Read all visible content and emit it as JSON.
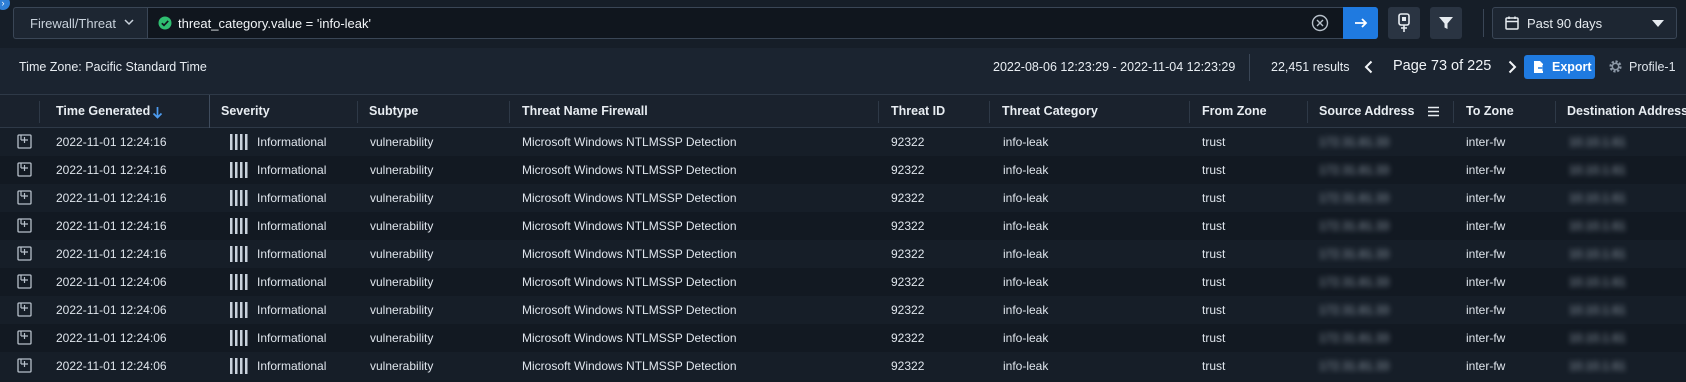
{
  "toolbar": {
    "datasource": "Firewall/Threat",
    "query": "threat_category.value = 'info-leak'",
    "time_range": "Past 90 days",
    "icons": {
      "status": "check-circle-icon",
      "clear": "clear-x-icon",
      "run": "arrow-right-icon",
      "query_builder": "query-builder-icon",
      "filter": "filter-icon",
      "calendar": "calendar-icon",
      "dropdown": "chevron-down-icon"
    },
    "colors": {
      "accent": "#1f7ae0",
      "status_ok": "#2fbf71"
    }
  },
  "info": {
    "timezone": "Time Zone: Pacific Standard Time",
    "date_range": "2022-08-06 12:23:29 - 2022-11-04 12:23:29",
    "results": "22,451 results",
    "page": "Page 73 of 225",
    "export_label": "Export",
    "profile_label": "Profile-1"
  },
  "table": {
    "columns": [
      "Time Generated",
      "Severity",
      "Subtype",
      "Threat Name Firewall",
      "Threat ID",
      "Threat Category",
      "From Zone",
      "Source Address",
      "To Zone",
      "Destination Address"
    ],
    "sort": {
      "column": "Time Generated",
      "direction": "descending"
    },
    "rows": [
      {
        "time": "2022-11-01 12:24:16",
        "severity": "Informational",
        "subtype": "vulnerability",
        "threat_name": "Microsoft Windows NTLMSSP Detection",
        "threat_id": "92322",
        "category": "info-leak",
        "from_zone": "trust",
        "source": "172.31.81.33",
        "to_zone": "inter-fw",
        "destination": "10.10.1.61"
      },
      {
        "time": "2022-11-01 12:24:16",
        "severity": "Informational",
        "subtype": "vulnerability",
        "threat_name": "Microsoft Windows NTLMSSP Detection",
        "threat_id": "92322",
        "category": "info-leak",
        "from_zone": "trust",
        "source": "172.31.81.33",
        "to_zone": "inter-fw",
        "destination": "10.10.1.61"
      },
      {
        "time": "2022-11-01 12:24:16",
        "severity": "Informational",
        "subtype": "vulnerability",
        "threat_name": "Microsoft Windows NTLMSSP Detection",
        "threat_id": "92322",
        "category": "info-leak",
        "from_zone": "trust",
        "source": "172.31.81.33",
        "to_zone": "inter-fw",
        "destination": "10.10.1.61"
      },
      {
        "time": "2022-11-01 12:24:16",
        "severity": "Informational",
        "subtype": "vulnerability",
        "threat_name": "Microsoft Windows NTLMSSP Detection",
        "threat_id": "92322",
        "category": "info-leak",
        "from_zone": "trust",
        "source": "172.31.81.33",
        "to_zone": "inter-fw",
        "destination": "10.10.1.61"
      },
      {
        "time": "2022-11-01 12:24:16",
        "severity": "Informational",
        "subtype": "vulnerability",
        "threat_name": "Microsoft Windows NTLMSSP Detection",
        "threat_id": "92322",
        "category": "info-leak",
        "from_zone": "trust",
        "source": "172.31.81.33",
        "to_zone": "inter-fw",
        "destination": "10.10.1.61"
      },
      {
        "time": "2022-11-01 12:24:06",
        "severity": "Informational",
        "subtype": "vulnerability",
        "threat_name": "Microsoft Windows NTLMSSP Detection",
        "threat_id": "92322",
        "category": "info-leak",
        "from_zone": "trust",
        "source": "172.31.81.33",
        "to_zone": "inter-fw",
        "destination": "10.10.1.61"
      },
      {
        "time": "2022-11-01 12:24:06",
        "severity": "Informational",
        "subtype": "vulnerability",
        "threat_name": "Microsoft Windows NTLMSSP Detection",
        "threat_id": "92322",
        "category": "info-leak",
        "from_zone": "trust",
        "source": "172.31.81.33",
        "to_zone": "inter-fw",
        "destination": "10.10.1.61"
      },
      {
        "time": "2022-11-01 12:24:06",
        "severity": "Informational",
        "subtype": "vulnerability",
        "threat_name": "Microsoft Windows NTLMSSP Detection",
        "threat_id": "92322",
        "category": "info-leak",
        "from_zone": "trust",
        "source": "172.31.81.33",
        "to_zone": "inter-fw",
        "destination": "10.10.1.61"
      },
      {
        "time": "2022-11-01 12:24:06",
        "severity": "Informational",
        "subtype": "vulnerability",
        "threat_name": "Microsoft Windows NTLMSSP Detection",
        "threat_id": "92322",
        "category": "info-leak",
        "from_zone": "trust",
        "source": "172.31.81.33",
        "to_zone": "inter-fw",
        "destination": "10.10.1.61"
      }
    ]
  }
}
